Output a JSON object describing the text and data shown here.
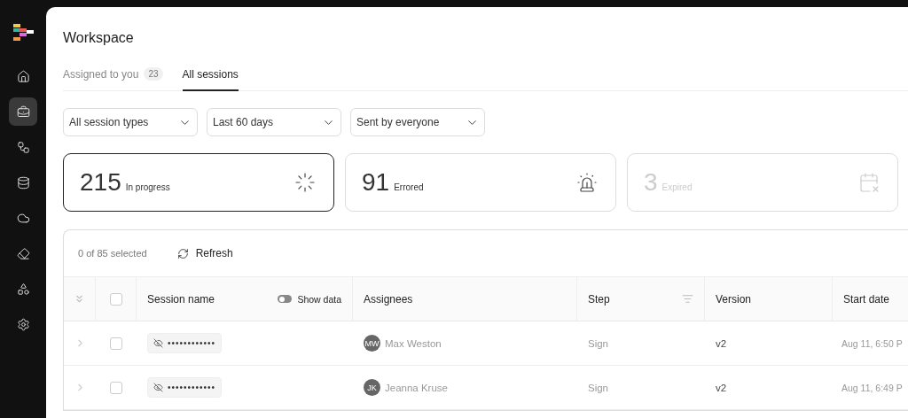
{
  "sidebar": {
    "items": [
      {
        "selected": false
      },
      {
        "selected": true
      },
      {
        "selected": false
      },
      {
        "selected": false
      },
      {
        "selected": false
      },
      {
        "selected": false
      },
      {
        "selected": false
      },
      {
        "selected": false
      }
    ]
  },
  "page": {
    "title": "Workspace"
  },
  "tabs": [
    {
      "label": "Assigned to you",
      "badge": "23",
      "selected": false
    },
    {
      "label": "All sessions",
      "selected": true
    }
  ],
  "filters": [
    {
      "value": "All session types"
    },
    {
      "value": "Last 60 days"
    },
    {
      "value": "Sent by everyone"
    }
  ],
  "stat_cards": [
    {
      "count": "215",
      "label": "In progress",
      "selected": true,
      "disabled": false
    },
    {
      "count": "91",
      "label": "Errored",
      "selected": false,
      "disabled": false
    },
    {
      "count": "3",
      "label": "Expired",
      "selected": false,
      "disabled": true
    }
  ],
  "table": {
    "selection_text": "0 of 85 selected",
    "refresh_label": "Refresh",
    "select_all_checked": false,
    "show_data": {
      "label": "Show data",
      "on": false
    },
    "columns": [
      {
        "label": "Session name"
      },
      {
        "label": "Assignees"
      },
      {
        "label": "Step"
      },
      {
        "label": "Version"
      },
      {
        "label": "Start date"
      }
    ],
    "rows": [
      {
        "expanded": false,
        "checked": false,
        "session_name": "••••••••••••",
        "assignee_initials": "MW",
        "assignee": "Max Weston",
        "step": "Sign",
        "version": "v2",
        "start_date": "Aug 11, 6:50 P"
      },
      {
        "expanded": false,
        "checked": false,
        "session_name": "••••••••••••",
        "assignee_initials": "JK",
        "assignee": "Jeanna Kruse",
        "step": "Sign",
        "version": "v2",
        "start_date": "Aug 11, 6:49 P"
      }
    ]
  }
}
